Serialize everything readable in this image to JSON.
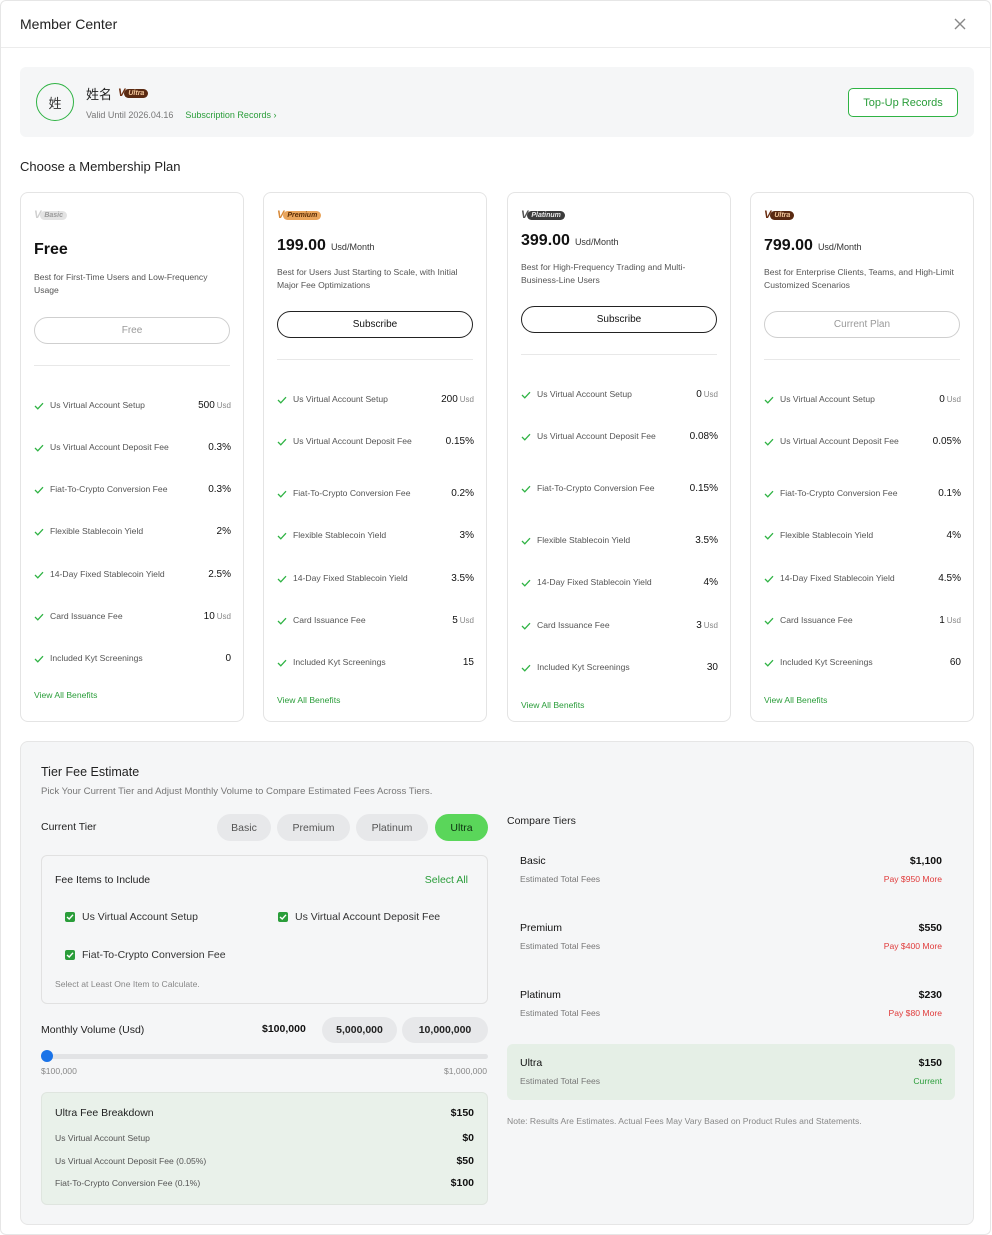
{
  "header": {
    "title": "Member Center"
  },
  "profile": {
    "avatar_char": "姓",
    "name": "姓名",
    "tier_badge": "Ultra",
    "valid_until": "Valid Until 2026.04.16",
    "subscription_link": "Subscription Records ›",
    "topup_label": "Top-Up Records"
  },
  "plans_title": "Choose a Membership Plan",
  "plans": [
    {
      "badge": "Basic",
      "price": "Free",
      "unit": "",
      "desc": "Best for First-Time Users and Low-Frequency Usage",
      "button": "Free",
      "button_style": "light",
      "benefits": [
        {
          "label": "Us Virtual Account Setup",
          "value": "500",
          "unit": "Usd"
        },
        {
          "label": "Us Virtual Account Deposit Fee",
          "value": "0.3%",
          "unit": ""
        },
        {
          "label": "Fiat-To-Crypto Conversion Fee",
          "value": "0.3%",
          "unit": ""
        },
        {
          "label": "Flexible Stablecoin Yield",
          "value": "2%",
          "unit": ""
        },
        {
          "label": "14-Day Fixed Stablecoin Yield",
          "value": "2.5%",
          "unit": ""
        },
        {
          "label": "Card Issuance Fee",
          "value": "10",
          "unit": "Usd"
        },
        {
          "label": "Included Kyt Screenings",
          "value": "0",
          "unit": ""
        }
      ],
      "view_all": "View All Benefits"
    },
    {
      "badge": "Premium",
      "price": "199.00",
      "unit": "Usd/Month",
      "desc": "Best for Users Just Starting to Scale, with Initial Major Fee Optimizations",
      "button": "Subscribe",
      "button_style": "dark",
      "benefits": [
        {
          "label": "Us Virtual Account Setup",
          "value": "200",
          "unit": "Usd"
        },
        {
          "label": "Us Virtual Account Deposit Fee",
          "value": "0.15%",
          "unit": ""
        },
        {
          "label": "Fiat-To-Crypto Conversion Fee",
          "value": "0.2%",
          "unit": ""
        },
        {
          "label": "Flexible Stablecoin Yield",
          "value": "3%",
          "unit": ""
        },
        {
          "label": "14-Day Fixed Stablecoin Yield",
          "value": "3.5%",
          "unit": ""
        },
        {
          "label": "Card Issuance Fee",
          "value": "5",
          "unit": "Usd"
        },
        {
          "label": "Included Kyt Screenings",
          "value": "15",
          "unit": ""
        }
      ],
      "view_all": "View All Benefits"
    },
    {
      "badge": "Platinum",
      "price": "399.00",
      "unit": "Usd/Month",
      "desc": "Best for High-Frequency Trading and Multi-Business-Line Users",
      "button": "Subscribe",
      "button_style": "dark",
      "benefits": [
        {
          "label": "Us Virtual Account Setup",
          "value": "0",
          "unit": "Usd"
        },
        {
          "label": "Us Virtual Account Deposit Fee",
          "value": "0.08%",
          "unit": ""
        },
        {
          "label": "Fiat-To-Crypto Conversion Fee",
          "value": "0.15%",
          "unit": ""
        },
        {
          "label": "Flexible Stablecoin Yield",
          "value": "3.5%",
          "unit": ""
        },
        {
          "label": "14-Day Fixed Stablecoin Yield",
          "value": "4%",
          "unit": ""
        },
        {
          "label": "Card Issuance Fee",
          "value": "3",
          "unit": "Usd"
        },
        {
          "label": "Included Kyt Screenings",
          "value": "30",
          "unit": ""
        }
      ],
      "view_all": "View All Benefits"
    },
    {
      "badge": "Ultra",
      "price": "799.00",
      "unit": "Usd/Month",
      "desc": "Best for Enterprise Clients, Teams, and High-Limit Customized Scenarios",
      "button": "Current Plan",
      "button_style": "light",
      "benefits": [
        {
          "label": "Us Virtual Account Setup",
          "value": "0",
          "unit": "Usd"
        },
        {
          "label": "Us Virtual Account Deposit Fee",
          "value": "0.05%",
          "unit": ""
        },
        {
          "label": "Fiat-To-Crypto Conversion Fee",
          "value": "0.1%",
          "unit": ""
        },
        {
          "label": "Flexible Stablecoin Yield",
          "value": "4%",
          "unit": ""
        },
        {
          "label": "14-Day Fixed Stablecoin Yield",
          "value": "4.5%",
          "unit": ""
        },
        {
          "label": "Card Issuance Fee",
          "value": "1",
          "unit": "Usd"
        },
        {
          "label": "Included Kyt Screenings",
          "value": "60",
          "unit": ""
        }
      ],
      "view_all": "View All Benefits"
    }
  ],
  "estimate": {
    "title": "Tier Fee Estimate",
    "subtitle": "Pick Your Current Tier and Adjust Monthly Volume to Compare Estimated Fees Across Tiers.",
    "current_tier_label": "Current Tier",
    "tiers": [
      "Basic",
      "Premium",
      "Platinum",
      "Ultra"
    ],
    "active_tier": "Ultra",
    "fee_items": {
      "title": "Fee Items to Include",
      "select_all": "Select All",
      "items": [
        "Us Virtual Account Setup",
        "Us Virtual Account Deposit Fee",
        "Fiat-To-Crypto Conversion Fee"
      ],
      "hint": "Select at Least One Item to Calculate."
    },
    "volume": {
      "label": "Monthly Volume (Usd)",
      "value": "$100,000",
      "chips": [
        "5,000,000",
        "10,000,000"
      ],
      "min": "$100,000",
      "max": "$1,000,000",
      "position": 0
    },
    "breakdown": {
      "title": "Ultra Fee Breakdown",
      "total": "$150",
      "rows": [
        {
          "label": "Us Virtual Account Setup",
          "value": "$0"
        },
        {
          "label": "Us Virtual Account Deposit Fee (0.05%)",
          "value": "$50"
        },
        {
          "label": "Fiat-To-Crypto Conversion Fee (0.1%)",
          "value": "$100"
        }
      ]
    },
    "compare": {
      "title": "Compare Tiers",
      "rows": [
        {
          "name": "Basic",
          "sub": "Estimated Total Fees",
          "total": "$1,100",
          "diff": "Pay $950 More",
          "current": false
        },
        {
          "name": "Premium",
          "sub": "Estimated Total Fees",
          "total": "$550",
          "diff": "Pay $400 More",
          "current": false
        },
        {
          "name": "Platinum",
          "sub": "Estimated Total Fees",
          "total": "$230",
          "diff": "Pay $80 More",
          "current": false
        },
        {
          "name": "Ultra",
          "sub": "Estimated Total Fees",
          "total": "$150",
          "diff": "Current",
          "current": true
        }
      ],
      "note": "Note: Results Are Estimates. Actual Fees May Vary Based on Product Rules and Statements."
    }
  },
  "colors": {
    "accent_green": "#2a9d3a",
    "active_tier_green": "#5ad65a",
    "more_red": "#e03b3b",
    "slider_blue": "#1a73e8"
  }
}
